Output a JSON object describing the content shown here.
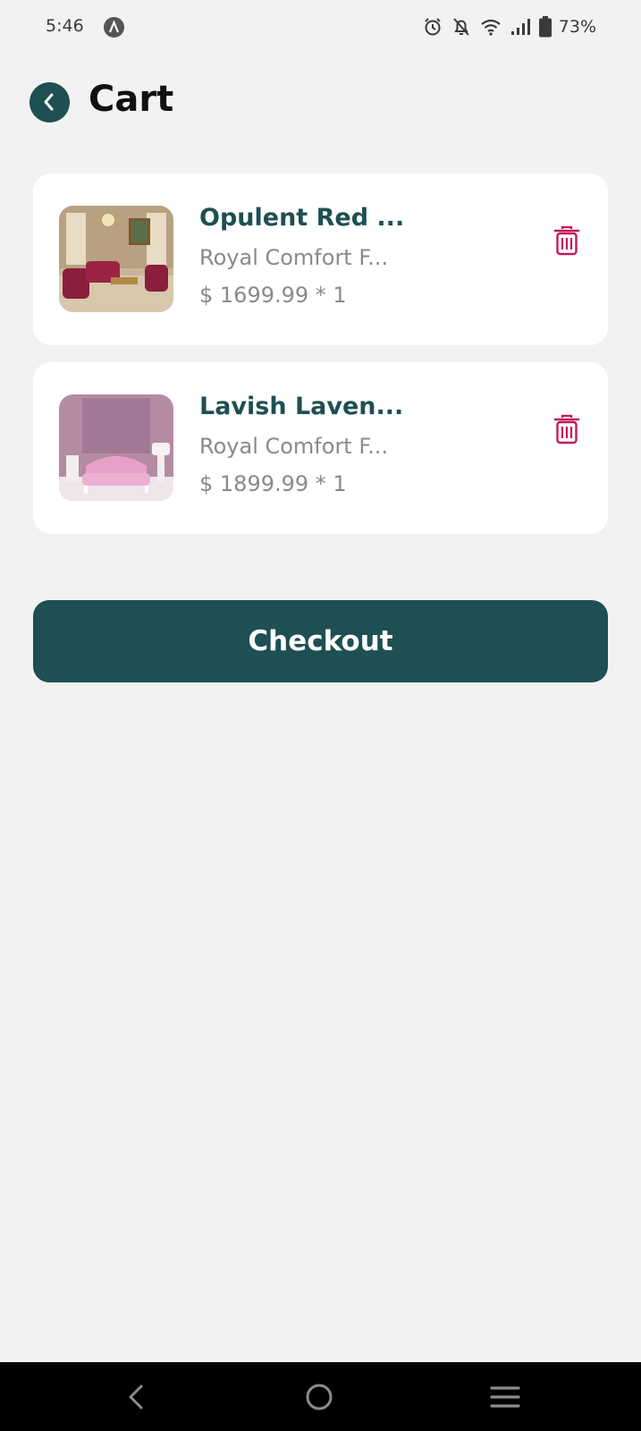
{
  "status_bar": {
    "time": "5:46",
    "battery": "73%",
    "icons": [
      "app-a-icon",
      "alarm-icon",
      "mute-icon",
      "wifi-icon",
      "signal-icon",
      "battery-icon"
    ]
  },
  "header": {
    "title": "Cart",
    "back_icon": "chevron-left-icon"
  },
  "cart": {
    "items": [
      {
        "name": "Opulent Red ...",
        "store": "Royal Comfort F...",
        "price": "$ 1699.99 * 1",
        "delete_icon": "trash-icon"
      },
      {
        "name": "Lavish Laven...",
        "store": "Royal Comfort F...",
        "price": "$ 1899.99 * 1",
        "delete_icon": "trash-icon"
      }
    ]
  },
  "checkout": {
    "label": "Checkout"
  },
  "nav": {
    "icons": [
      "nav-back-icon",
      "nav-home-icon",
      "nav-recents-icon"
    ]
  },
  "colors": {
    "primary": "#1e4f52",
    "background": "#f2f2f2",
    "delete": "#c2185b",
    "muted_text": "#8a8a8a"
  }
}
